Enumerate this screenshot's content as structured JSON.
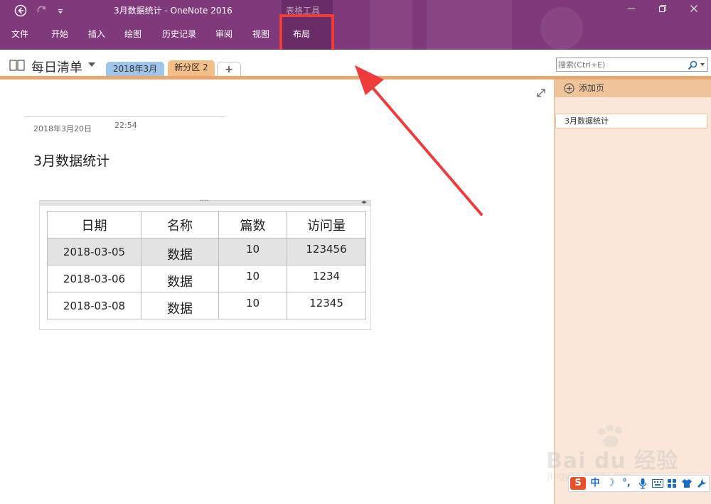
{
  "titlebar": {
    "document_title": "3月数据统计  -  OneNote 2016",
    "context_tab_title": "表格工具",
    "colors": {
      "background": "#80397b",
      "context_group": "#6a2c66"
    },
    "quick_access": {
      "back_icon": "back-circle-arrow-icon",
      "redo_icon": "redo-icon",
      "customize_icon": "customize-qat-icon"
    },
    "window_controls": {
      "minimize_icon": "minimize-icon",
      "restore_icon": "restore-icon",
      "close_icon": "close-icon"
    }
  },
  "menu": {
    "items": [
      {
        "label": "文件"
      },
      {
        "label": "开始"
      },
      {
        "label": "插入"
      },
      {
        "label": "绘图"
      },
      {
        "label": "历史记录"
      },
      {
        "label": "审阅"
      },
      {
        "label": "视图"
      },
      {
        "label": "布局"
      }
    ]
  },
  "notebook": {
    "name": "每日清单",
    "icon": "notebook-icon",
    "sections": [
      {
        "label": "2018年3月",
        "color": "#9fc6ea"
      },
      {
        "label": "新分区 2",
        "color": "#f3be87"
      },
      {
        "label": "+",
        "color": "#ffffff"
      }
    ]
  },
  "search": {
    "placeholder": "搜索(Ctrl+E)",
    "icon": "magnifier-icon"
  },
  "page": {
    "date": "2018年3月20日",
    "time": "22:54",
    "title": "3月数据统计",
    "table": {
      "headers": [
        "日期",
        "名称",
        "篇数",
        "访问量"
      ],
      "rows": [
        [
          "2018-03-05",
          "数据",
          "10",
          "123456"
        ],
        [
          "2018-03-06",
          "数据",
          "10",
          "1234"
        ],
        [
          "2018-03-08",
          "数据",
          "10",
          "12345"
        ]
      ],
      "selected_row": 0
    }
  },
  "pagelist": {
    "add_page_label": "添加页",
    "pages": [
      {
        "label": "3月数据统计"
      }
    ],
    "colors": {
      "background": "#fbe7d9",
      "header": "#f0c49a"
    }
  },
  "ime_toolbar": {
    "mode_label": "中",
    "icons": [
      "sogou-s-icon",
      "moon-icon",
      "punctuation-icon",
      "microphone-icon",
      "keyboard-icon",
      "skin-shirt-icon",
      "wrench-icon"
    ]
  },
  "watermark": {
    "text": "Bai du 经验",
    "url": "jingyan.baidu.com"
  },
  "annotation": {
    "color": "#ef3b3b"
  }
}
